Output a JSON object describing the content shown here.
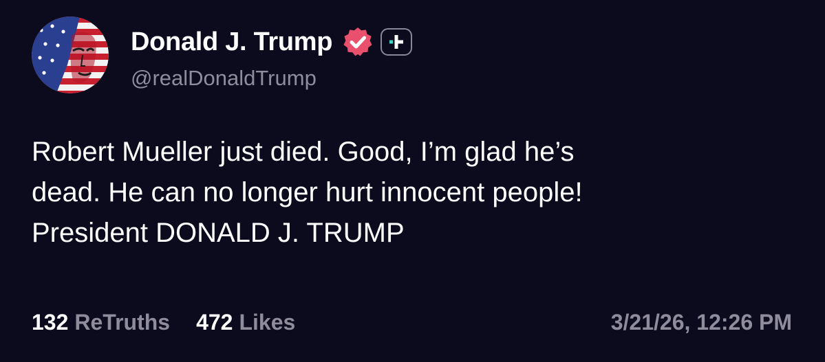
{
  "post": {
    "author": {
      "display_name": "Donald J. Trump",
      "handle": "@realDonaldTrump",
      "avatar_icon": "flag-portrait-avatar",
      "verified_icon": "verified-badge-icon",
      "verified_color": "#e8506d",
      "plus_icon": "truth-plus-icon",
      "plus_accent": "#3fd6c4"
    },
    "text": "Robert Mueller just died. Good, I’m glad he’s\ndead. He can no longer hurt innocent people!\nPresident DONALD J. TRUMP",
    "stats": {
      "retruths_count": "132",
      "retruths_label": "ReTruths",
      "likes_count": "472",
      "likes_label": "Likes"
    },
    "timestamp": "3/21/26, 12:26 PM"
  },
  "colors": {
    "background": "#0c0a1d",
    "primary_text": "#ffffff",
    "secondary_text": "#8f8c9c"
  }
}
